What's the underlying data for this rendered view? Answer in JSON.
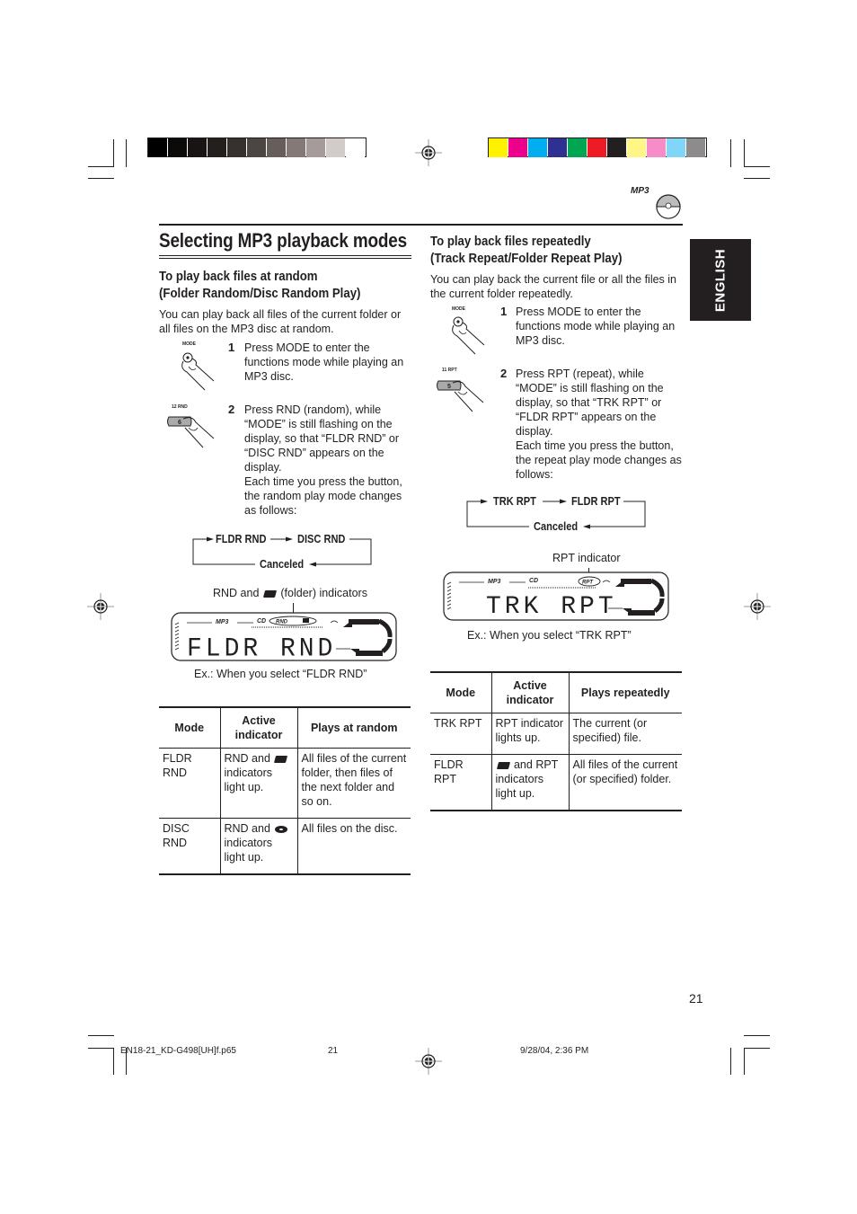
{
  "colors": {
    "grayscale_bar": [
      "#000000",
      "#0b0a09",
      "#171413",
      "#231f1d",
      "#36302e",
      "#4d4542",
      "#675e5a",
      "#847976",
      "#a59c99",
      "#d3cbca",
      "#ffffff"
    ],
    "color_bar": [
      "#fff200",
      "#ec008c",
      "#00aeef",
      "#2e3192",
      "#00a651",
      "#ed1c24",
      "#231f20",
      "#fff685",
      "#f68dc8",
      "#7fd6f7",
      "#8d8b8b"
    ],
    "ink": "#231f20",
    "tab_bg": "#231f20"
  },
  "header": {
    "mp3_logo": "MP3",
    "page_title": "Selecting MP3 playback modes"
  },
  "side_tab": {
    "label": "ENGLISH"
  },
  "random_section": {
    "heading_line1": "To play back files at random",
    "heading_line2": "(Folder Random/Disc Random Play)",
    "intro": "You can play back all files of the current folder or all files on the MP3 disc at random.",
    "steps": [
      {
        "number": "1",
        "button_label": "MODE",
        "text": "Press MODE to enter the functions mode while playing an MP3 disc."
      },
      {
        "number": "2",
        "button_label": "12 RND",
        "button_key": "6",
        "text": "Press RND (random), while “MODE” is still flashing on the display, so that “FLDR RND” or “DISC RND” appears on the display.",
        "text2": "Each time you press the button, the random play mode changes as follows:"
      }
    ],
    "cycle": {
      "first": "FLDR RND",
      "second": "DISC RND",
      "third": "Canceled"
    },
    "indicator_caption_pre": "RND and",
    "indicator_caption_post": "(folder) indicators",
    "display": {
      "segment_text": "FLDR RND",
      "mp3": "MP3",
      "cd": "CD",
      "rnd": "RND"
    },
    "example_caption": "Ex.:  When you select “FLDR RND”",
    "table": {
      "headers": [
        "Mode",
        "Active indicator",
        "Plays at random"
      ],
      "rows": [
        {
          "mode": "FLDR RND",
          "indicator_pre": "RND and",
          "indicator_icon": "folder-icon",
          "indicator_post": "indicators light up.",
          "plays": "All files of the current folder, then files of the next folder and so on."
        },
        {
          "mode": "DISC RND",
          "indicator_pre": "RND and",
          "indicator_icon": "disc-icon",
          "indicator_post": "indicators light up.",
          "plays": "All files on the disc."
        }
      ]
    }
  },
  "repeat_section": {
    "heading_line1": "To play back files repeatedly",
    "heading_line2": "(Track Repeat/Folder Repeat Play)",
    "intro": "You can play back the current file or all the files in the current folder repeatedly.",
    "steps": [
      {
        "number": "1",
        "button_label": "MODE",
        "text": "Press MODE to enter the functions mode while playing an MP3 disc."
      },
      {
        "number": "2",
        "button_label": "11 RPT",
        "button_key": "5",
        "text": "Press RPT (repeat), while “MODE” is still flashing on the display, so that “TRK RPT” or “FLDR RPT” appears on the display.",
        "text2": "Each time you press the button, the repeat play mode changes as follows:"
      }
    ],
    "cycle": {
      "first": "TRK RPT",
      "second": "FLDR RPT",
      "third": "Canceled"
    },
    "indicator_caption": "RPT indicator",
    "display": {
      "segment_text": "TRK RPT",
      "mp3": "MP3",
      "cd": "CD",
      "rpt": "RPT"
    },
    "example_caption": "Ex.:  When you select “TRK RPT”",
    "table": {
      "headers": [
        "Mode",
        "Active indicator",
        "Plays repeatedly"
      ],
      "rows": [
        {
          "mode": "TRK RPT",
          "indicator_text": "RPT indicator lights up.",
          "plays": "The current (or specified) file."
        },
        {
          "mode": "FLDR RPT",
          "indicator_icon": "folder-icon",
          "indicator_post": "and RPT indicators light up.",
          "plays": "All files of the current (or specified) folder."
        }
      ]
    }
  },
  "page_number": "21",
  "footer": {
    "filename": "EN18-21_KD-G498[UH]f.p65",
    "page": "21",
    "timestamp": "9/28/04, 2:36 PM"
  }
}
